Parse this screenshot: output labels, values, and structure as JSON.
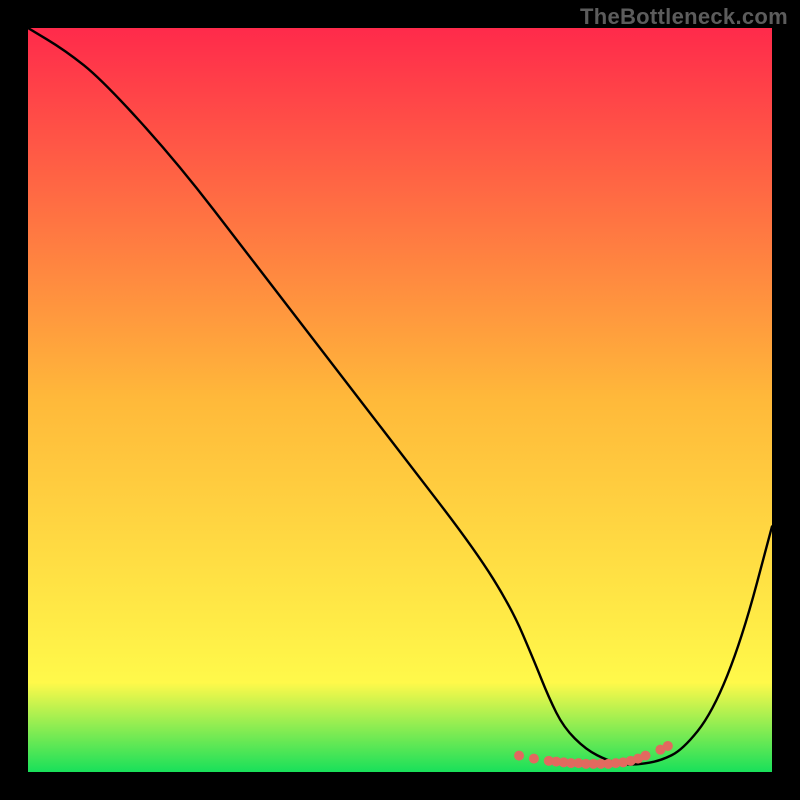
{
  "watermark": "TheBottleneck.com",
  "chart_data": {
    "type": "line",
    "title": "",
    "xlabel": "",
    "ylabel": "",
    "xlim": [
      0,
      100
    ],
    "ylim": [
      0,
      100
    ],
    "grid": false,
    "background_gradient_top": "#ff2a4b",
    "background_gradient_mid": "#ffb93a",
    "background_gradient_low": "#fff94a",
    "background_gradient_bottom": "#18e05a",
    "series": [
      {
        "name": "curve",
        "color": "#000000",
        "x": [
          0,
          5,
          10,
          20,
          30,
          40,
          50,
          60,
          65,
          68,
          70,
          72,
          75,
          78,
          80,
          82,
          85,
          88,
          92,
          96,
          100
        ],
        "y": [
          100,
          97,
          93,
          82,
          69,
          56,
          43,
          30,
          22,
          15,
          10,
          6,
          3,
          1.5,
          1,
          1,
          1.5,
          3,
          8,
          18,
          33
        ]
      }
    ],
    "markers": {
      "name": "bottom-dots",
      "color": "#e2695f",
      "x": [
        66,
        68,
        70,
        71,
        72,
        73,
        74,
        75,
        76,
        77,
        78,
        79,
        80,
        81,
        82,
        83,
        85,
        86
      ],
      "y": [
        2.2,
        1.8,
        1.5,
        1.4,
        1.3,
        1.2,
        1.2,
        1.1,
        1.1,
        1.1,
        1.1,
        1.2,
        1.3,
        1.5,
        1.8,
        2.2,
        3.0,
        3.5
      ]
    }
  }
}
